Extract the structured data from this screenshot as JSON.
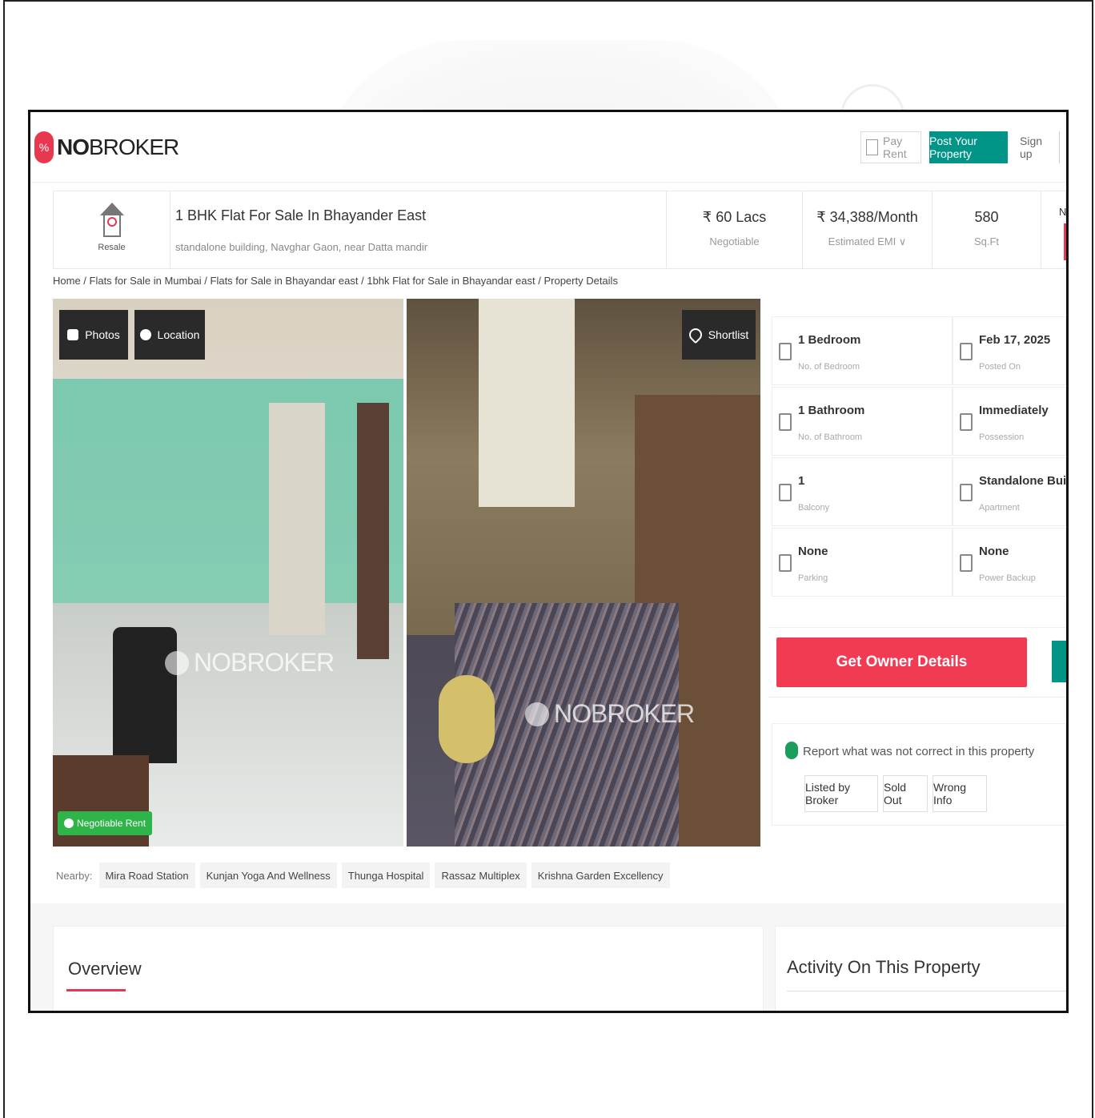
{
  "brand": {
    "name_bold": "NO",
    "name_rest": "BROKER"
  },
  "header": {
    "pay_rent": "Pay Rent",
    "post_property": "Post Your Property",
    "sign_up": "Sign up"
  },
  "summary": {
    "badge": "Resale",
    "title": "1 BHK Flat For Sale In Bhayander East",
    "subtitle": "standalone building, Navghar Gaon, near Datta mandir",
    "price": {
      "value": "₹ 60 Lacs",
      "label": "Negotiable"
    },
    "emi": {
      "value": "₹ 34,388/Month",
      "label": "Estimated EMI ∨"
    },
    "area": {
      "value": "580",
      "label": "Sq.Ft"
    },
    "cut_label": "Ne"
  },
  "breadcrumb": "Home / Flats for Sale in Mumbai / Flats for Sale in Bhayandar east / 1bhk Flat for Sale in Bhayandar east / Property Details",
  "gallery": {
    "photos_btn": "Photos",
    "location_btn": "Location",
    "shortlist_btn": "Shortlist",
    "watermark": "NOBROKER",
    "badge": "Negotiable Rent"
  },
  "specs": [
    {
      "value": "1 Bedroom",
      "label": "No. of Bedroom",
      "icon": "bed-icon"
    },
    {
      "value": "Feb 17, 2025",
      "label": "Posted On",
      "icon": "calendar-icon"
    },
    {
      "value": "1 Bathroom",
      "label": "No. of Bathroom",
      "icon": "bath-icon"
    },
    {
      "value": "Immediately",
      "label": "Possession",
      "icon": "key-icon"
    },
    {
      "value": "1",
      "label": "Balcony",
      "icon": "balcony-icon"
    },
    {
      "value": "Standalone Building",
      "label": "Apartment",
      "icon": "building-icon"
    },
    {
      "value": "None",
      "label": "Parking",
      "icon": "car-icon"
    },
    {
      "value": "None",
      "label": "Power Backup",
      "icon": "power-icon"
    }
  ],
  "owner_btn": "Get Owner Details",
  "report": {
    "title": "Report what was not correct in this property",
    "buttons": [
      "Listed by Broker",
      "Sold Out",
      "Wrong Info"
    ]
  },
  "nearby": {
    "label": "Nearby:",
    "places": [
      "Mira Road Station",
      "Kunjan Yoga And Wellness",
      "Thunga Hospital",
      "Rassaz Multiplex",
      "Krishna Garden Excellency"
    ]
  },
  "overview_title": "Overview",
  "activity_title": "Activity On This Property",
  "colors": {
    "brand_red": "#e8384f",
    "teal": "#009587",
    "cta_red": "#f23b53"
  }
}
